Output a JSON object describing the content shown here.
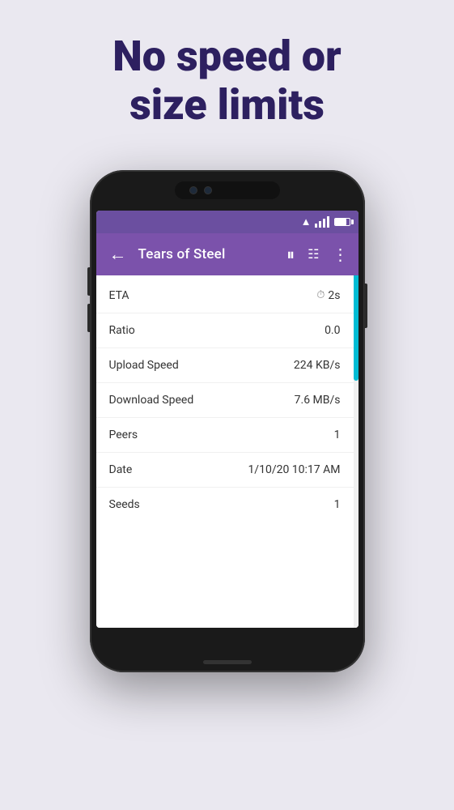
{
  "headline": {
    "line1": "No speed or",
    "line2": "size limits"
  },
  "toolbar": {
    "title": "Tears of Steel",
    "back_icon": "←",
    "pause_icon": "⏸",
    "list_icon": "☰",
    "more_icon": "⋮"
  },
  "status_bar": {
    "wifi_icon": "▲",
    "signal_icon": "▌▌▌",
    "battery_label": "battery"
  },
  "info_rows": [
    {
      "label": "ETA",
      "value": "2s",
      "has_clock": true
    },
    {
      "label": "Ratio",
      "value": "0.0",
      "has_clock": false
    },
    {
      "label": "Upload Speed",
      "value": "224 KB/s",
      "has_clock": false
    },
    {
      "label": "Download Speed",
      "value": "7.6 MB/s",
      "has_clock": false
    },
    {
      "label": "Peers",
      "value": "1",
      "has_clock": false
    },
    {
      "label": "Date",
      "value": "1/10/20 10:17 AM",
      "has_clock": false
    },
    {
      "label": "Seeds",
      "value": "1",
      "has_clock": false
    }
  ],
  "colors": {
    "background": "#eae8f0",
    "headline": "#2d2060",
    "toolbar": "#7b52ab",
    "progress": "#00bcd4"
  }
}
